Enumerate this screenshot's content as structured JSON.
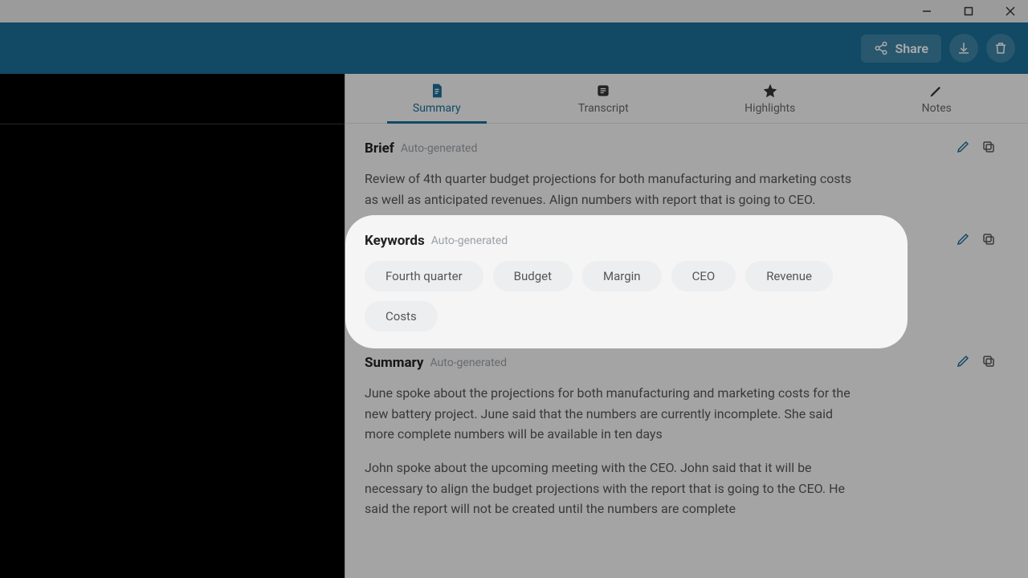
{
  "titlebar": {
    "buttons": {
      "minimize": "minimize",
      "maximize": "maximize",
      "close": "close"
    }
  },
  "appbar": {
    "share_label": "Share"
  },
  "tabs": [
    {
      "label": "Summary",
      "active": true
    },
    {
      "label": "Transcript",
      "active": false
    },
    {
      "label": "Highlights",
      "active": false
    },
    {
      "label": "Notes",
      "active": false
    }
  ],
  "sections": {
    "brief": {
      "title": "Brief",
      "tag": "Auto-generated",
      "body": "Review of 4th quarter budget projections for both manufacturing and marketing costs as well as anticipated revenues. Align numbers with report that is going to CEO."
    },
    "keywords": {
      "title": "Keywords",
      "tag": "Auto-generated",
      "chips": [
        "Fourth quarter",
        "Budget",
        "Margin",
        "CEO",
        "Revenue",
        "Costs"
      ]
    },
    "summary": {
      "title": "Summary",
      "tag": "Auto-generated",
      "paragraphs": [
        "June spoke about the projections for both manufacturing and marketing costs for the new battery project. June said that the numbers are currently incomplete. She said more complete numbers will be available in ten days",
        "John spoke about the upcoming meeting with the CEO. John said that it will be necessary to align the budget projections with the report that is going to the CEO. He said the report will not be created until the numbers are complete"
      ]
    }
  }
}
